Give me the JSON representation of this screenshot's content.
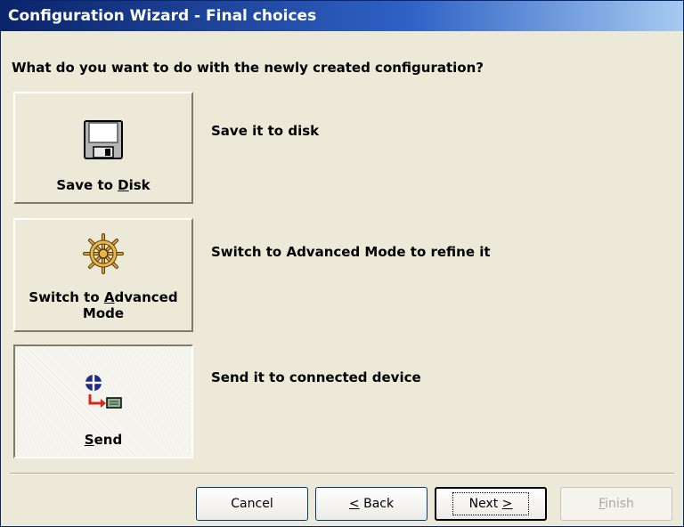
{
  "window": {
    "title": "Configuration Wizard - Final choices"
  },
  "question": "What do you want to do with the newly created configuration?",
  "options": [
    {
      "label_before": "Save to ",
      "label_mnemonic": "D",
      "label_after": "isk",
      "icon": "floppy-disk-icon",
      "description": "Save it to disk"
    },
    {
      "label_before": "Switch to ",
      "label_mnemonic": "A",
      "label_after": "dvanced Mode",
      "icon": "ship-wheel-icon",
      "description": "Switch to Advanced Mode to refine it"
    },
    {
      "label_before": "",
      "label_mnemonic": "S",
      "label_after": "end",
      "icon": "send-to-device-icon",
      "description": "Send it to connected device"
    }
  ],
  "buttons": {
    "cancel": "Cancel",
    "back_mnemonic": "<",
    "back_after": " Back",
    "next_before": "Next ",
    "next_mnemonic": ">",
    "finish_mnemonic": "F",
    "finish_after": "inish"
  },
  "colors": {
    "titlebar_start": "#0a246a",
    "titlebar_end": "#a6caf0",
    "face": "#ece9d8",
    "disabled_text": "#aca899"
  }
}
